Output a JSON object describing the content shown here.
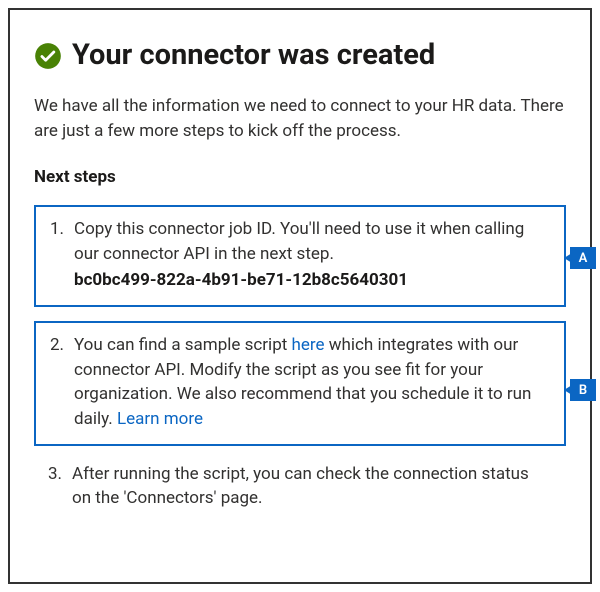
{
  "header": {
    "icon": "success-check-icon",
    "title": "Your connector was created"
  },
  "intro": "We have all the information we need to connect to your HR data. There are just a few more steps to kick off the process.",
  "nextSteps": {
    "heading": "Next steps",
    "steps": [
      {
        "num": "1.",
        "text": "Copy this connector job ID. You'll need to use it when calling our connector API in the next step.",
        "jobId": "bc0bc499-822a-4b91-be71-12b8c5640301",
        "callout": "A"
      },
      {
        "num": "2.",
        "textBefore": "You can find a sample script ",
        "hereLink": "here",
        "textAfter": " which integrates with our connector API. Modify the script as you see fit for your organization. We also recommend that you schedule it to run daily. ",
        "learnMoreLink": "Learn more",
        "callout": "B"
      },
      {
        "num": "3.",
        "text": "After running the script, you can check the connection status on the 'Connectors' page."
      }
    ]
  },
  "colors": {
    "accent": "#0b66c3",
    "success": "#498205"
  }
}
